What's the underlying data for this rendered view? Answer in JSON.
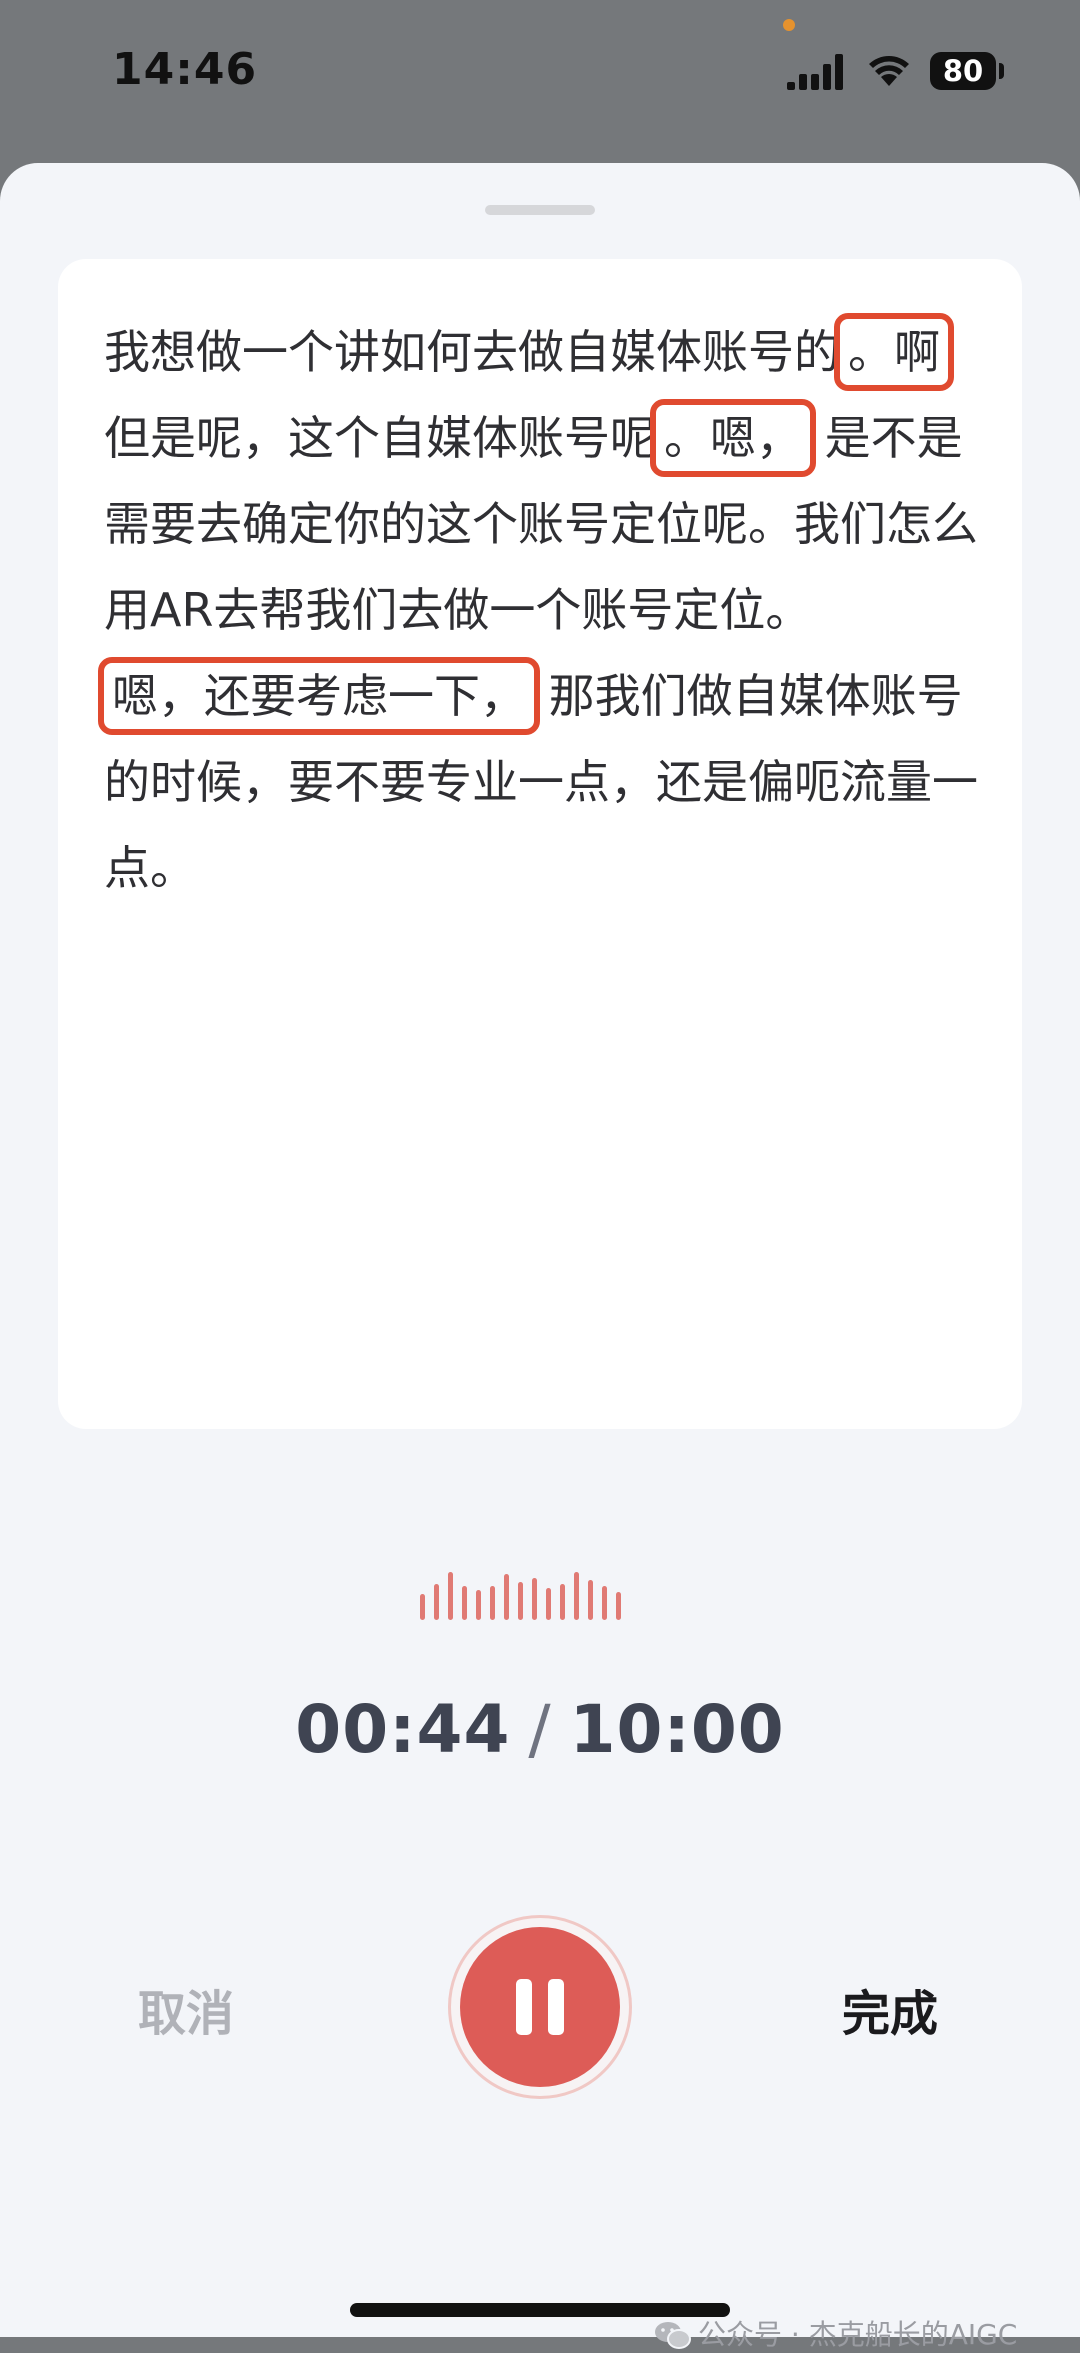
{
  "status_bar": {
    "time": "14:46",
    "battery": "80"
  },
  "transcript": {
    "segments": [
      "我想做一个讲如何去做自媒体账号的",
      "。啊",
      "但是呢，这个自媒体账号呢",
      "。嗯，",
      "是不是需要去确定你的这个账号定位呢。我们怎么用AR去帮我们去做一个账号定位。",
      "嗯，还要考虑一下，",
      "那我们做自媒体账号的时候，要不要专业一点，还是偏呃流量一点。"
    ]
  },
  "recording": {
    "elapsed": "00:44",
    "separator": "/",
    "limit": "10:00"
  },
  "controls": {
    "cancel_label": "取消",
    "done_label": "完成"
  },
  "watermark": {
    "text": "公众号 · 杰克船长的AIGC"
  },
  "colors": {
    "accent_red": "#dd5c57",
    "highlight_border": "#e04a2f"
  }
}
